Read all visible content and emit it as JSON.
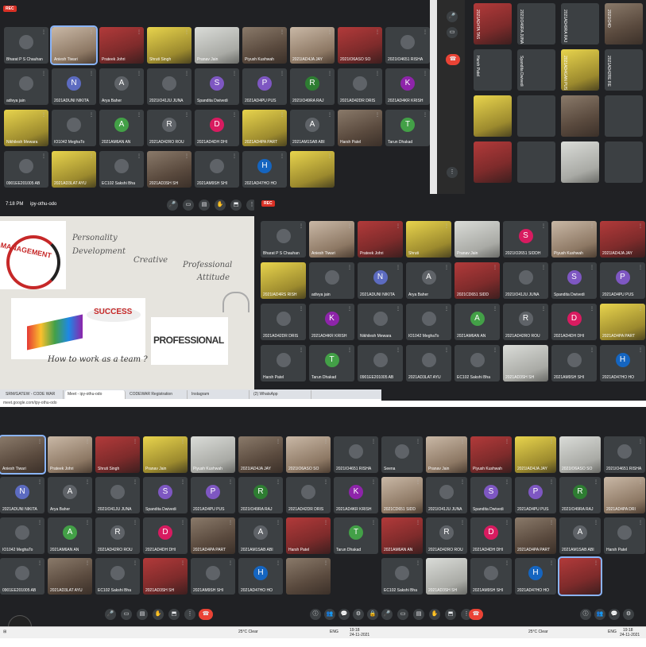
{
  "rec_label": "REC",
  "status_time": "7:18 PM",
  "meeting_code": "ipy-othu-odo",
  "colors": {
    "background": "#202124",
    "tile": "#3c4043",
    "end_call": "#ea4335",
    "rec": "#d93025",
    "active_border": "#8ab4f8"
  },
  "panel1": {
    "tiles": [
      {
        "name": "Bharat P S Chauhan",
        "initial": "",
        "color": "#5f6368",
        "video": false
      },
      {
        "name": "Aniesh Tiwari",
        "initial": "",
        "color": "",
        "video": true,
        "active": true
      },
      {
        "name": "Prateek Johri",
        "initial": "",
        "color": "",
        "video": true
      },
      {
        "name": "Shruti Singh",
        "initial": "",
        "color": "",
        "video": true
      },
      {
        "name": "Pranav Jain",
        "initial": "",
        "color": "",
        "video": true
      },
      {
        "name": "Piyush Kushwah",
        "initial": "",
        "color": "",
        "video": true
      },
      {
        "name": "2021IAD4JA JAY",
        "initial": "",
        "color": "",
        "video": true
      },
      {
        "name": "2021IO6ASO SO",
        "initial": "",
        "color": "",
        "video": true
      },
      {
        "name": "2021IO4651 RISHA",
        "initial": "",
        "color": "#5f6368",
        "video": false
      },
      {
        "name": "adivya jain",
        "initial": "",
        "color": "#5f6368",
        "video": false
      },
      {
        "name": "2021ADUNI NIKITA",
        "initial": "N",
        "color": "#5c6bc0",
        "video": false
      },
      {
        "name": "Arya Baher",
        "initial": "A",
        "color": "#5f6368",
        "video": false
      },
      {
        "name": "2021IO41JU JUNA",
        "initial": "",
        "color": "#5f6368",
        "video": false
      },
      {
        "name": "Spandita Dwivedi",
        "initial": "S",
        "color": "#7e57c2",
        "video": false
      },
      {
        "name": "2021AD4PU PUS",
        "initial": "P",
        "color": "#7e57c2",
        "video": false
      },
      {
        "name": "2021IO49RA RAJ",
        "initial": "R",
        "color": "#2e7d32",
        "video": false
      },
      {
        "name": "2021AD42DR DRIS",
        "initial": "",
        "color": "#5f6368",
        "video": false
      },
      {
        "name": "2021AD4KR KRISH",
        "initial": "K",
        "color": "#8e24aa",
        "video": false
      },
      {
        "name": "Nikhilesh Mewara",
        "initial": "",
        "color": "",
        "video": true
      },
      {
        "name": "IO1042 MeghaTo",
        "initial": "",
        "color": "#5f6368",
        "video": false
      },
      {
        "name": "2021AM6AN AN",
        "initial": "A",
        "color": "#43a047",
        "video": false
      },
      {
        "name": "2021AD42RO ROU",
        "initial": "R",
        "color": "#5f6368",
        "video": false
      },
      {
        "name": "2021AD4DH DHI",
        "initial": "D",
        "color": "#d81b60",
        "video": false
      },
      {
        "name": "2021AD4PA PART",
        "initial": "",
        "color": "",
        "video": true
      },
      {
        "name": "2021AM1SAB ABI",
        "initial": "A",
        "color": "#5f6368",
        "video": false
      },
      {
        "name": "Harsh Patel",
        "initial": "",
        "color": "",
        "video": true
      },
      {
        "name": "Tarun Dhakad",
        "initial": "T",
        "color": "#43a047",
        "video": false
      },
      {
        "name": "0901EE201005 AB",
        "initial": "",
        "color": "#5f6368",
        "video": false
      },
      {
        "name": "2021AD3LAT AYU",
        "initial": "",
        "color": "",
        "video": true
      },
      {
        "name": "EC102 Sakshi Bha",
        "initial": "",
        "color": "#5f6368",
        "video": false
      },
      {
        "name": "2021AD3SH SH",
        "initial": "",
        "color": "",
        "video": true
      },
      {
        "name": "2021AM9SH SHI",
        "initial": "",
        "color": "#5f6368",
        "video": false
      },
      {
        "name": "2021AD47HO HO",
        "initial": "H",
        "color": "#1565c0",
        "video": false
      },
      {
        "name": "",
        "initial": "",
        "color": "",
        "video": true
      }
    ]
  },
  "slide": {
    "words": [
      "Personality",
      "Development",
      "Creative",
      "Professional",
      "Attitude",
      "SUCCESS",
      "PROFESSIONAL",
      "How to work as a team ?",
      "MANAGEMENT"
    ]
  },
  "panel3": {
    "tiles": [
      {
        "name": "Bharat P S Chauhan",
        "initial": "",
        "color": "#5f6368",
        "video": false
      },
      {
        "name": "Aniesh Tiwari",
        "initial": "",
        "color": "",
        "video": true
      },
      {
        "name": "Prateek Johri",
        "initial": "",
        "color": "",
        "video": true
      },
      {
        "name": "Shruti",
        "initial": "",
        "color": "",
        "video": true
      },
      {
        "name": "Pranav Jain",
        "initial": "",
        "color": "",
        "video": true
      },
      {
        "name": "2021IO2651 SIDDH",
        "initial": "S",
        "color": "#d81b60",
        "video": false
      },
      {
        "name": "Piyush Kushwah",
        "initial": "",
        "color": "",
        "video": true
      },
      {
        "name": "2021IAD4JA JAY",
        "initial": "",
        "color": "",
        "video": true
      },
      {
        "name": "2021IAD4RS RISH",
        "initial": "",
        "color": "",
        "video": true
      },
      {
        "name": "adivya jain",
        "initial": "",
        "color": "#5f6368",
        "video": false
      },
      {
        "name": "2021ADUNI NIKITA",
        "initial": "N",
        "color": "#5c6bc0",
        "video": false
      },
      {
        "name": "Arya Baher",
        "initial": "A",
        "color": "#5f6368",
        "video": false
      },
      {
        "name": "2021CD651 SIDD",
        "initial": "",
        "color": "",
        "video": true
      },
      {
        "name": "2021IO41JU JUNA",
        "initial": "",
        "color": "#5f6368",
        "video": false
      },
      {
        "name": "Spandita Dwivedi",
        "initial": "S",
        "color": "#7e57c2",
        "video": false
      },
      {
        "name": "2021AD4PU PUS",
        "initial": "P",
        "color": "#7e57c2",
        "video": false
      },
      {
        "name": "2021AD42DR DRIS",
        "initial": "",
        "color": "#5f6368",
        "video": false
      },
      {
        "name": "2021AD4KR KRISH",
        "initial": "K",
        "color": "#8e24aa",
        "video": false
      },
      {
        "name": "Nikhilesh Mewara",
        "initial": "",
        "color": "#5f6368",
        "video": false
      },
      {
        "name": "IO1042 MeghaTo",
        "initial": "",
        "color": "#5f6368",
        "video": false
      },
      {
        "name": "2021AM6AN AN",
        "initial": "A",
        "color": "#43a047",
        "video": false
      },
      {
        "name": "2021AD42RO ROU",
        "initial": "R",
        "color": "#5f6368",
        "video": false
      },
      {
        "name": "2021AD4DH DHI",
        "initial": "D",
        "color": "#d81b60",
        "video": false
      },
      {
        "name": "2021AD4PA PART",
        "initial": "",
        "color": "",
        "video": true
      },
      {
        "name": "Harsh Patel",
        "initial": "",
        "color": "#5f6368",
        "video": false
      },
      {
        "name": "Tarun Dhakad",
        "initial": "T",
        "color": "#43a047",
        "video": false
      },
      {
        "name": "0901EE201005 AB",
        "initial": "",
        "color": "#5f6368",
        "video": false
      },
      {
        "name": "2021AD3LAT AYU",
        "initial": "",
        "color": "#5f6368",
        "video": false
      },
      {
        "name": "EC102 Sakshi Bha",
        "initial": "",
        "color": "#5f6368",
        "video": false
      },
      {
        "name": "2021AD3SH SH",
        "initial": "",
        "color": "",
        "video": true
      },
      {
        "name": "2021AM9SH SHI",
        "initial": "",
        "color": "#5f6368",
        "video": false
      },
      {
        "name": "2021AD47HO HO",
        "initial": "H",
        "color": "#1565c0",
        "video": false
      }
    ]
  },
  "browser": {
    "tabs": [
      "SRM/GATEW - CODE WAR",
      "Meet - ipy-othu-odo",
      "CODEWAR Registration",
      "Instagram",
      "(2) WhatsApp"
    ],
    "url": "meet.google.com/ipy-othu-odo"
  },
  "panel4": {
    "tiles": [
      {
        "name": "Aniesh Tiwari",
        "initial": "",
        "color": "",
        "video": true,
        "active": true
      },
      {
        "name": "Prateek Johri",
        "initial": "",
        "color": "",
        "video": true
      },
      {
        "name": "Shruti Singh",
        "initial": "",
        "color": "",
        "video": true
      },
      {
        "name": "Pranav Jain",
        "initial": "",
        "color": "",
        "video": true
      },
      {
        "name": "Piyush Kushwah",
        "initial": "",
        "color": "",
        "video": true
      },
      {
        "name": "2021IAD4JA JAY",
        "initial": "",
        "color": "",
        "video": true
      },
      {
        "name": "2021IO6ASO SO",
        "initial": "",
        "color": "",
        "video": true
      },
      {
        "name": "2021IO4651 RISHA",
        "initial": "",
        "color": "#5f6368",
        "video": false
      },
      {
        "name": "2021ADUNI NIKITA",
        "initial": "N",
        "color": "#5c6bc0",
        "video": false
      },
      {
        "name": "Arya Baher",
        "initial": "A",
        "color": "#5f6368",
        "video": false
      },
      {
        "name": "2021IO41JU JUNA",
        "initial": "",
        "color": "#5f6368",
        "video": false
      },
      {
        "name": "Spandita Dwivedi",
        "initial": "S",
        "color": "#7e57c2",
        "video": false
      },
      {
        "name": "2021AD4PU PUS",
        "initial": "P",
        "color": "#7e57c2",
        "video": false
      },
      {
        "name": "2021IO49RA RAJ",
        "initial": "R",
        "color": "#2e7d32",
        "video": false
      },
      {
        "name": "2021AD42DR DRIS",
        "initial": "",
        "color": "#5f6368",
        "video": false
      },
      {
        "name": "2021AD4KR KRISH",
        "initial": "K",
        "color": "#8e24aa",
        "video": false
      },
      {
        "name": "IO1042 MeghaTo",
        "initial": "",
        "color": "#5f6368",
        "video": false
      },
      {
        "name": "2021AM6AN AN",
        "initial": "A",
        "color": "#43a047",
        "video": false
      },
      {
        "name": "2021AD42RO ROU",
        "initial": "R",
        "color": "#5f6368",
        "video": false
      },
      {
        "name": "2021AD4DH DHI",
        "initial": "D",
        "color": "#d81b60",
        "video": false
      },
      {
        "name": "2021AD4PA PART",
        "initial": "",
        "color": "",
        "video": true
      },
      {
        "name": "2021AM1SAB ABI",
        "initial": "A",
        "color": "#5f6368",
        "video": false
      },
      {
        "name": "Harsh Patel",
        "initial": "",
        "color": "",
        "video": true
      },
      {
        "name": "Tarun Dhakad",
        "initial": "T",
        "color": "#43a047",
        "video": false
      },
      {
        "name": "0901EE201005 AB",
        "initial": "",
        "color": "#5f6368",
        "video": false
      },
      {
        "name": "2021AD3LAT AYU",
        "initial": "",
        "color": "",
        "video": true
      },
      {
        "name": "EC102 Sakshi Bha",
        "initial": "",
        "color": "#5f6368",
        "video": false
      },
      {
        "name": "2021AD3SH SH",
        "initial": "",
        "color": "",
        "video": true
      },
      {
        "name": "2021AM9SH SHI",
        "initial": "",
        "color": "#5f6368",
        "video": false
      },
      {
        "name": "2021AD47HO HO",
        "initial": "H",
        "color": "#1565c0",
        "video": false
      },
      {
        "name": "",
        "initial": "",
        "color": "",
        "video": true
      }
    ]
  },
  "panel5": {
    "tiles": [
      {
        "name": "Seena",
        "initial": "",
        "color": "#5f6368",
        "video": false
      },
      {
        "name": "Pranav Jain",
        "initial": "",
        "color": "",
        "video": true
      },
      {
        "name": "Piyush Kushwah",
        "initial": "",
        "color": "",
        "video": true
      },
      {
        "name": "2021IAD4JA JAY",
        "initial": "",
        "color": "",
        "video": true
      },
      {
        "name": "2021IO6ASO SO",
        "initial": "",
        "color": "",
        "video": true
      },
      {
        "name": "2021IO4651 RISHA",
        "initial": "",
        "color": "#5f6368",
        "video": false
      },
      {
        "name": "2021CD651 SIDD",
        "initial": "",
        "color": "",
        "video": true
      },
      {
        "name": "2021IO41JU JUNA",
        "initial": "",
        "color": "#5f6368",
        "video": false
      },
      {
        "name": "Spandita Dwivedi",
        "initial": "S",
        "color": "#7e57c2",
        "video": false
      },
      {
        "name": "2021AD4PU PUS",
        "initial": "P",
        "color": "#7e57c2",
        "video": false
      },
      {
        "name": "2021IO49RA RAJ",
        "initial": "R",
        "color": "#2e7d32",
        "video": false
      },
      {
        "name": "2021AD4PA DRI",
        "initial": "",
        "color": "",
        "video": true
      },
      {
        "name": "2021AM6AN AN",
        "initial": "",
        "color": "",
        "video": true
      },
      {
        "name": "2021AD42RO ROU",
        "initial": "R",
        "color": "#5f6368",
        "video": false
      },
      {
        "name": "2021AD4DH DHI",
        "initial": "D",
        "color": "#d81b60",
        "video": false
      },
      {
        "name": "2021AD4PA PART",
        "initial": "",
        "color": "",
        "video": true
      },
      {
        "name": "2021AM1SAB ABI",
        "initial": "A",
        "color": "#5f6368",
        "video": false
      },
      {
        "name": "Harsh Patel",
        "initial": "",
        "color": "#5f6368",
        "video": false
      },
      {
        "name": "EC102 Sakshi Bha",
        "initial": "",
        "color": "#5f6368",
        "video": false
      },
      {
        "name": "2021AD3SH SH",
        "initial": "",
        "color": "",
        "video": true
      },
      {
        "name": "2021AM9SH SHI",
        "initial": "",
        "color": "#5f6368",
        "video": false
      },
      {
        "name": "2021AD47HO HO",
        "initial": "H",
        "color": "#1565c0",
        "video": false
      },
      {
        "name": "",
        "initial": "",
        "color": "",
        "video": true,
        "active": true
      }
    ]
  },
  "panel2": {
    "names": [
      "2021AD4TA TAS",
      "2021IO46RA JUNA",
      "2021AD49RA RAJ",
      "2021IO4D",
      "Harsh Patel",
      "Spandita Dwivedi",
      "2021AD4GAN PUS",
      "2021AD42RE RE"
    ]
  },
  "taskbar": {
    "weather": "25°C Clear",
    "lang": "ENG",
    "time": "19:18",
    "date": "24-11-2021"
  }
}
